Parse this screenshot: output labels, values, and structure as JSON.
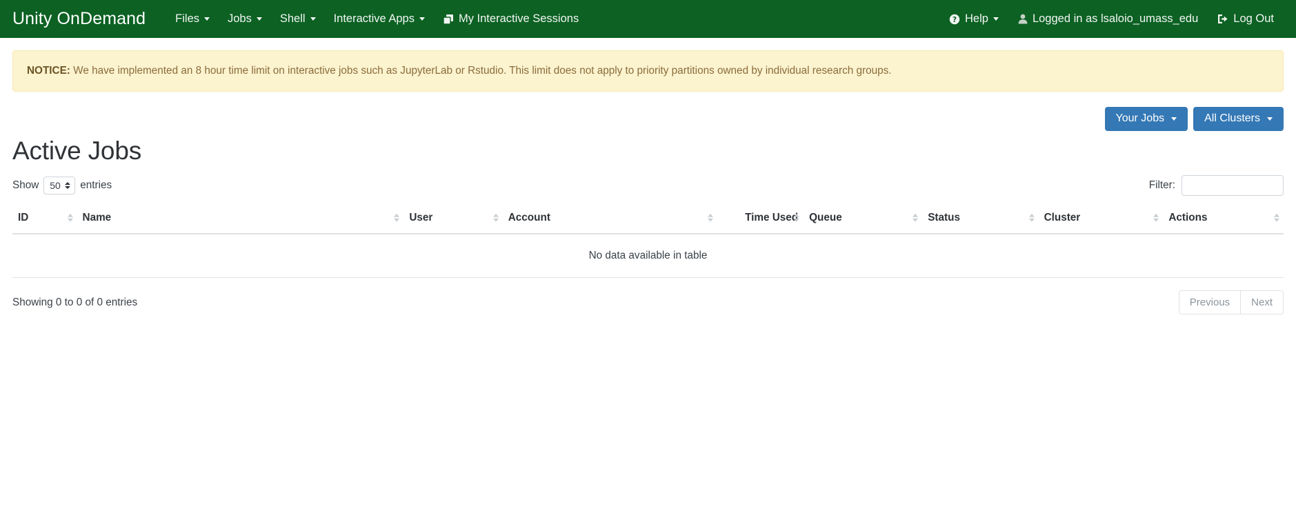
{
  "navbar": {
    "brand": "Unity OnDemand",
    "left_items": [
      {
        "label": "Files",
        "has_caret": true,
        "icon": null
      },
      {
        "label": "Jobs",
        "has_caret": true,
        "icon": null
      },
      {
        "label": "Shell",
        "has_caret": true,
        "icon": null
      },
      {
        "label": "Interactive Apps",
        "has_caret": true,
        "icon": null
      },
      {
        "label": "My Interactive Sessions",
        "has_caret": false,
        "icon": "windows-stack-icon"
      }
    ],
    "right_items": [
      {
        "label": "Help",
        "has_caret": true,
        "icon": "question-circle-icon"
      },
      {
        "label": "Logged in as lsaloio_umass_edu",
        "has_caret": false,
        "icon": "user-icon"
      },
      {
        "label": "Log Out",
        "has_caret": false,
        "icon": "sign-out-icon"
      }
    ],
    "background_color": "#0c6123"
  },
  "notice": {
    "label": "NOTICE",
    "separator": ":",
    "text": " We have implemented an 8 hour time limit on interactive jobs such as JupyterLab or Rstudio. This limit does not apply to priority partitions owned by individual research groups.",
    "background_color": "#fcf3cf",
    "text_color": "#8a6d3b"
  },
  "actions": {
    "your_jobs_label": "Your Jobs",
    "all_clusters_label": "All Clusters",
    "button_color": "#3478b5"
  },
  "page": {
    "title": "Active Jobs"
  },
  "table_controls": {
    "show_label": "Show",
    "entries_label": "entries",
    "page_length_value": "50",
    "filter_label": "Filter:",
    "filter_value": "",
    "filter_placeholder": ""
  },
  "table": {
    "columns": [
      {
        "key": "id",
        "label": "ID",
        "sortable": true
      },
      {
        "key": "name",
        "label": "Name",
        "sortable": true
      },
      {
        "key": "user",
        "label": "User",
        "sortable": true
      },
      {
        "key": "account",
        "label": "Account",
        "sortable": true
      },
      {
        "key": "time_used",
        "label": "Time Used",
        "sortable": true
      },
      {
        "key": "queue",
        "label": "Queue",
        "sortable": true
      },
      {
        "key": "status",
        "label": "Status",
        "sortable": true
      },
      {
        "key": "cluster",
        "label": "Cluster",
        "sortable": true
      },
      {
        "key": "actions",
        "label": "Actions",
        "sortable": true
      }
    ],
    "rows": [],
    "empty_message": "No data available in table"
  },
  "table_footer": {
    "info": "Showing 0 to 0 of 0 entries",
    "previous_label": "Previous",
    "next_label": "Next"
  }
}
